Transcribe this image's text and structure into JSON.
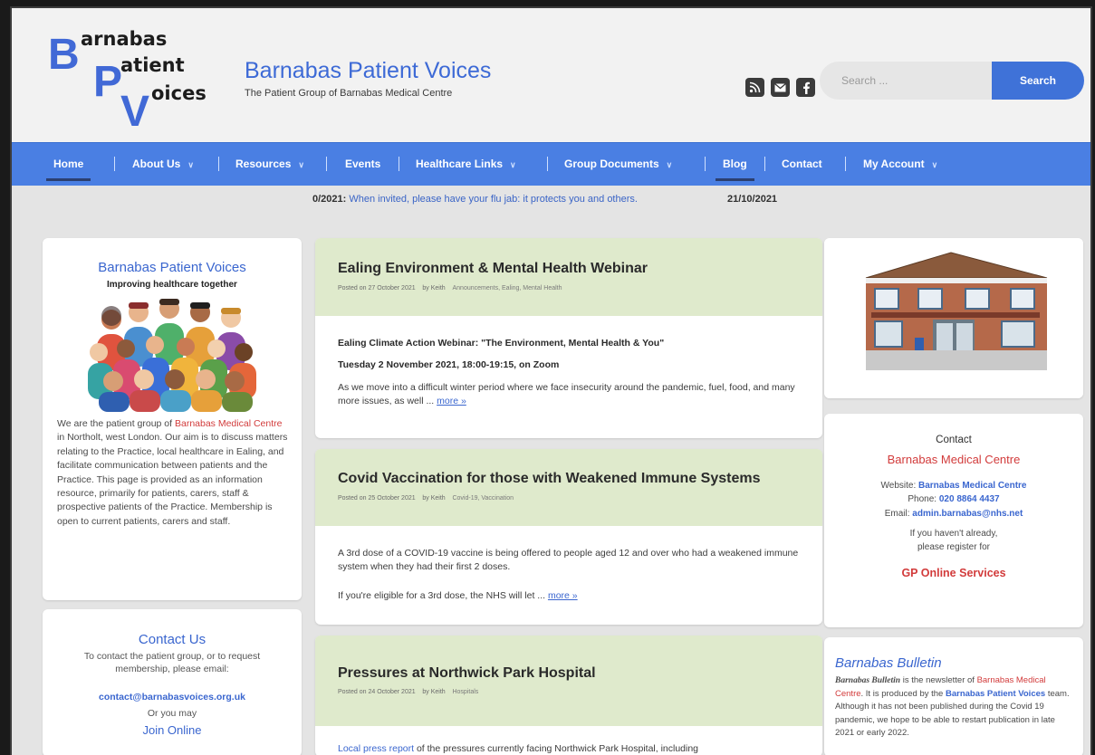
{
  "logo": {
    "letters": [
      "B",
      "P",
      "V"
    ],
    "words": [
      "arnabas",
      "atient",
      "oices"
    ]
  },
  "site": {
    "title": "Barnabas Patient Voices",
    "tagline": "The Patient Group of Barnabas Medical Centre"
  },
  "social": [
    "rss-icon",
    "email-icon",
    "facebook-icon"
  ],
  "search": {
    "placeholder": "Search ...",
    "button": "Search"
  },
  "nav": {
    "items": [
      {
        "label": "Home",
        "dropdown": false,
        "active": true
      },
      {
        "label": "About Us",
        "dropdown": true
      },
      {
        "label": "Resources",
        "dropdown": true
      },
      {
        "label": "Events",
        "dropdown": false
      },
      {
        "label": "Healthcare Links",
        "dropdown": true
      },
      {
        "label": "Group Documents",
        "dropdown": true
      },
      {
        "label": "Blog",
        "dropdown": false,
        "active": true
      },
      {
        "label": "Contact",
        "dropdown": false
      },
      {
        "label": "My Account",
        "dropdown": true
      }
    ],
    "chevron": "∨"
  },
  "ticker": {
    "prefix": "0/2021:",
    "text": "When invited, please have your flu jab: it protects you and others.",
    "date": "21/10/2021"
  },
  "about": {
    "title": "Barnabas Patient Voices",
    "subtitle": "Improving healthcare together",
    "text_pre": "We are the patient group of ",
    "text_link": "Barnabas Medical Centre",
    "text_post": " in Northolt, west London. Our aim is to discuss matters relating to the Practice, local healthcare in Ealing, and facilitate communication between patients and the Practice. This page is provided as an information resource, primarily for patients, carers, staff & prospective patients of the Practice. Membership is open to current patients, carers and staff."
  },
  "contact": {
    "title": "Contact Us",
    "text": "To contact the patient group, or to request membership, please email:",
    "email": "contact@barnabasvoices.org.uk",
    "or": "Or you may",
    "join": "Join Online"
  },
  "posts": [
    {
      "title": "Ealing Environment & Mental Health Webinar",
      "posted": "Posted on 27 October 2021",
      "author": "by Keith",
      "categories": "Announcements, Ealing, Mental Health",
      "p1": "Ealing Climate Action Webinar: \"The Environment, Mental Health & You\"",
      "p2": "Tuesday 2 November 2021, 18:00-19:15, on Zoom",
      "p3": "As we move into a difficult winter period where we face insecurity around the pandemic, fuel, food, and many more issues, as well ...",
      "more": "more »"
    },
    {
      "title": "Covid Vaccination for those with Weakened Immune Systems",
      "posted": "Posted on 25 October 2021",
      "author": "by Keith",
      "categories": "Covid-19, Vaccination",
      "p1": "A 3rd dose of a COVID-19 vaccine is being offered to people aged 12 and over who had a weakened immune system when they had their first 2 doses.",
      "p2": "If you're eligible for a 3rd dose, the NHS will let ...",
      "more": "more »"
    },
    {
      "title": "Pressures at Northwick Park Hospital",
      "posted": "Posted on 24 October 2021",
      "author": "by Keith",
      "categories": "Hospitals",
      "p1_link": "Local press report",
      "p1": " of the pressures currently facing Northwick Park Hospital, including"
    }
  ],
  "right_contact": {
    "title": "Contact",
    "name": "Barnabas Medical Centre",
    "website_label": "Website: ",
    "website": "Barnabas Medical Centre",
    "phone_label": "Phone: ",
    "phone": "020 8864 4437",
    "email_label": "Email: ",
    "email": "admin.barnabas@nhs.net",
    "line1": "If you haven't already,",
    "line2": "please register for",
    "gp": "GP Online Services"
  },
  "bulletin": {
    "title": "Barnabas Bulletin",
    "name": "Barnabas Bulletin",
    "t1": " is the newsletter of ",
    "bmc": "Barnabas Medical Centre",
    "t2": ". It is produced by the ",
    "bpv": "Barnabas Patient Voices",
    "t3": " team. Although it has not been published during the Covid 19 pandemic, we hope to be able to restart publication in late 2021 or early 2022."
  },
  "colors": {
    "brand_blue": "#4a7fe3",
    "link_blue": "#3a66cf",
    "accent_red": "#d23b3b",
    "post_header": "#dfeacc"
  }
}
